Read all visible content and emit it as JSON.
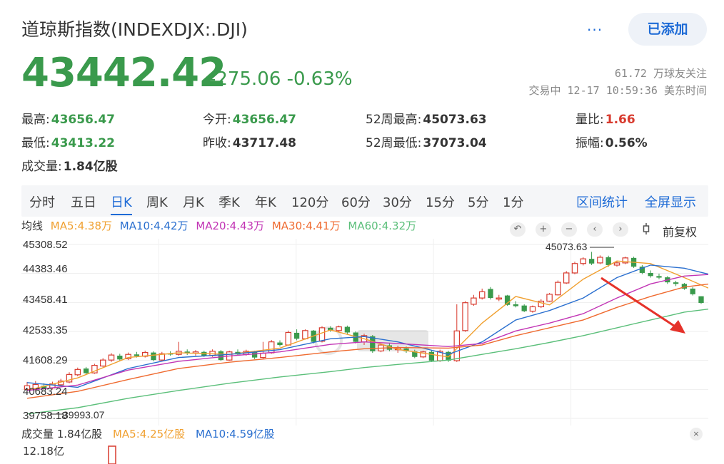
{
  "header": {
    "title": "道琼斯指数(INDEXDJX:.DJI)",
    "more_label": "···",
    "add_label": "已添加",
    "price": "43442.42",
    "change": "-275.06 -0.63%",
    "followers": "61.72 万球友关注",
    "trade_time": "交易中 12-17 10:59:36 美东时间"
  },
  "stats": {
    "high_label": "最高:",
    "high": "43656.47",
    "open_label": "今开:",
    "open": "43656.47",
    "w52high_label": "52周最高:",
    "w52high": "45073.63",
    "volratio_label": "量比:",
    "volratio": "1.66",
    "low_label": "最低:",
    "low": "43413.22",
    "prevclose_label": "昨收:",
    "prevclose": "43717.48",
    "w52low_label": "52周最低:",
    "w52low": "37073.04",
    "amplitude_label": "振幅:",
    "amplitude": "0.56%",
    "volume_label": "成交量:",
    "volume": "1.84亿股"
  },
  "tabs": [
    "分时",
    "五日",
    "日K",
    "周K",
    "月K",
    "季K",
    "年K",
    "120分",
    "60分",
    "30分",
    "15分",
    "5分",
    "1分"
  ],
  "active_tab": "日K",
  "tab_links": {
    "range_stats": "区间统计",
    "fullscreen": "全屏显示"
  },
  "ma": {
    "label": "均线",
    "ma5": "MA5:4.38万",
    "ma10": "MA10:4.42万",
    "ma20": "MA20:4.43万",
    "ma30": "MA30:4.41万",
    "ma60": "MA60:4.32万"
  },
  "controls": {
    "undo": "↶",
    "zoom_in": "+",
    "zoom_out": "−",
    "prev": "‹",
    "next": "›",
    "fuquan": "前复权"
  },
  "colors": {
    "up": "#d83a2e",
    "down": "#3a9a4c",
    "ma5": "#f0a030",
    "ma10": "#2a6fcf",
    "ma20": "#c235b5",
    "ma30": "#ef6a2f",
    "ma60": "#5bbf7a",
    "accent": "#1e6bd6"
  },
  "chart_data": {
    "type": "candlestick",
    "y_ticks": [
      "45308.52",
      "44383.46",
      "43458.41",
      "42533.35",
      "41608.29",
      "40683.24",
      "39758.18"
    ],
    "ylim": [
      39758.18,
      45308.52
    ],
    "annotations": {
      "max": "45073.63",
      "min": "39993.07"
    },
    "candles": [
      [
        40683,
        40800,
        40600,
        40920
      ],
      [
        40700,
        40840,
        40640,
        40950
      ],
      [
        40800,
        40720,
        40660,
        40880
      ],
      [
        40730,
        40860,
        40680,
        40930
      ],
      [
        40830,
        40950,
        40790,
        41020
      ],
      [
        40920,
        41160,
        40880,
        41230
      ],
      [
        41150,
        41320,
        41100,
        41380
      ],
      [
        41350,
        41200,
        41150,
        41400
      ],
      [
        41210,
        41450,
        41180,
        41500
      ],
      [
        41430,
        41620,
        41400,
        41680
      ],
      [
        41620,
        41780,
        41560,
        41840
      ],
      [
        41760,
        41640,
        41600,
        41820
      ],
      [
        41660,
        41800,
        41620,
        41860
      ],
      [
        41800,
        41750,
        41700,
        41880
      ],
      [
        41740,
        41860,
        41700,
        41920
      ],
      [
        41860,
        41620,
        41580,
        41900
      ],
      [
        41620,
        41820,
        41590,
        41880
      ],
      [
        41830,
        41800,
        41760,
        41900
      ],
      [
        41800,
        41900,
        41760,
        42200
      ],
      [
        41890,
        41850,
        41780,
        41960
      ],
      [
        41840,
        41880,
        41760,
        41940
      ],
      [
        41880,
        41760,
        41720,
        41920
      ],
      [
        41760,
        41900,
        41720,
        41960
      ],
      [
        41900,
        41620,
        41590,
        41940
      ],
      [
        41620,
        41880,
        41600,
        41920
      ],
      [
        41880,
        41800,
        41770,
        41960
      ],
      [
        41800,
        41900,
        41760,
        41950
      ],
      [
        41880,
        41700,
        41650,
        41920
      ],
      [
        41700,
        41840,
        41660,
        42200
      ],
      [
        41850,
        42200,
        41820,
        42260
      ],
      [
        42180,
        42100,
        42050,
        42250
      ],
      [
        42100,
        42500,
        42070,
        42560
      ],
      [
        42490,
        42300,
        42250,
        42600
      ],
      [
        42300,
        42560,
        42270,
        42600
      ],
      [
        42560,
        42200,
        42150,
        42580
      ],
      [
        42220,
        42650,
        42180,
        42700
      ],
      [
        42650,
        42560,
        42520,
        42700
      ],
      [
        42560,
        42680,
        42520,
        42720
      ],
      [
        42680,
        42500,
        42450,
        42720
      ],
      [
        42500,
        42200,
        42150,
        42540
      ],
      [
        42200,
        42400,
        42100,
        42460
      ],
      [
        42380,
        41900,
        41850,
        42420
      ],
      [
        41910,
        42100,
        41870,
        42150
      ],
      [
        42090,
        41950,
        41900,
        42150
      ],
      [
        41950,
        42000,
        41850,
        42080
      ],
      [
        41990,
        41900,
        41850,
        42050
      ],
      [
        41900,
        41720,
        41680,
        41950
      ],
      [
        41720,
        41880,
        41680,
        41920
      ],
      [
        41880,
        41600,
        41560,
        41920
      ],
      [
        41600,
        41900,
        41560,
        41950
      ],
      [
        41880,
        41600,
        41560,
        41920
      ],
      [
        41600,
        42550,
        41560,
        43400
      ],
      [
        42560,
        43450,
        42520,
        43500
      ],
      [
        43400,
        43600,
        43350,
        43700
      ],
      [
        43600,
        43800,
        43550,
        43900
      ],
      [
        43890,
        43600,
        43550,
        43950
      ],
      [
        43600,
        43600,
        43500,
        43700
      ],
      [
        43680,
        43380,
        43350,
        43700
      ],
      [
        43400,
        43340,
        43300,
        43500
      ],
      [
        43360,
        43180,
        43150,
        43400
      ],
      [
        43180,
        43320,
        43130,
        43360
      ],
      [
        43320,
        43500,
        43280,
        43560
      ],
      [
        43500,
        43720,
        43480,
        43760
      ],
      [
        43700,
        44100,
        43680,
        44160
      ],
      [
        44080,
        44400,
        44050,
        44460
      ],
      [
        44400,
        44700,
        44360,
        44760
      ],
      [
        44700,
        44850,
        44640,
        44900
      ],
      [
        44850,
        44700,
        44650,
        45073.63
      ],
      [
        44720,
        44900,
        44680,
        44960
      ],
      [
        44900,
        44650,
        44600,
        44950
      ],
      [
        44650,
        44720,
        44600,
        44780
      ],
      [
        44720,
        44880,
        44680,
        44920
      ],
      [
        44880,
        44600,
        44560,
        44920
      ],
      [
        44600,
        44400,
        44360,
        44650
      ],
      [
        44400,
        44300,
        44250,
        44480
      ],
      [
        44300,
        44250,
        44200,
        44380
      ],
      [
        44260,
        44100,
        44050,
        44300
      ],
      [
        44100,
        44050,
        43980,
        44150
      ],
      [
        44050,
        43900,
        43860,
        44080
      ],
      [
        43900,
        43720,
        43680,
        43950
      ],
      [
        43656.47,
        43442.42,
        43413.22,
        43656.47
      ]
    ],
    "ma_lines": {
      "ma5": [
        [
          0,
          40650
        ],
        [
          6,
          41050
        ],
        [
          12,
          41700
        ],
        [
          18,
          41850
        ],
        [
          24,
          41800
        ],
        [
          30,
          42000
        ],
        [
          36,
          42580
        ],
        [
          40,
          42300
        ],
        [
          44,
          41960
        ],
        [
          50,
          41720
        ],
        [
          54,
          42800
        ],
        [
          58,
          43650
        ],
        [
          62,
          43380
        ],
        [
          66,
          44200
        ],
        [
          70,
          44780
        ],
        [
          74,
          44700
        ],
        [
          78,
          44250
        ],
        [
          81,
          43900
        ]
      ],
      "ma10": [
        [
          0,
          40900
        ],
        [
          6,
          40750
        ],
        [
          12,
          41350
        ],
        [
          18,
          41700
        ],
        [
          24,
          41800
        ],
        [
          30,
          41950
        ],
        [
          36,
          42300
        ],
        [
          40,
          42370
        ],
        [
          44,
          42200
        ],
        [
          50,
          41800
        ],
        [
          54,
          42200
        ],
        [
          58,
          42900
        ],
        [
          62,
          43200
        ],
        [
          66,
          43600
        ],
        [
          70,
          44250
        ],
        [
          74,
          44650
        ],
        [
          78,
          44550
        ],
        [
          81,
          44350
        ]
      ],
      "ma20": [
        [
          0,
          40650
        ],
        [
          6,
          40820
        ],
        [
          12,
          41300
        ],
        [
          18,
          41580
        ],
        [
          24,
          41750
        ],
        [
          30,
          41880
        ],
        [
          36,
          42120
        ],
        [
          40,
          42200
        ],
        [
          44,
          42150
        ],
        [
          50,
          42050
        ],
        [
          54,
          42150
        ],
        [
          58,
          42550
        ],
        [
          62,
          42800
        ],
        [
          66,
          43100
        ],
        [
          70,
          43600
        ],
        [
          74,
          44050
        ],
        [
          78,
          44300
        ],
        [
          81,
          44350
        ]
      ],
      "ma30": [
        [
          0,
          40400
        ],
        [
          6,
          40620
        ],
        [
          12,
          41000
        ],
        [
          18,
          41350
        ],
        [
          24,
          41550
        ],
        [
          30,
          41700
        ],
        [
          36,
          41880
        ],
        [
          40,
          41980
        ],
        [
          44,
          42020
        ],
        [
          50,
          42000
        ],
        [
          54,
          42100
        ],
        [
          58,
          42400
        ],
        [
          62,
          42650
        ],
        [
          66,
          42900
        ],
        [
          70,
          43300
        ],
        [
          74,
          43650
        ],
        [
          78,
          43950
        ],
        [
          81,
          44050
        ]
      ],
      "ma60": [
        [
          0,
          39900
        ],
        [
          6,
          40100
        ],
        [
          12,
          40400
        ],
        [
          18,
          40650
        ],
        [
          24,
          40880
        ],
        [
          30,
          41080
        ],
        [
          36,
          41250
        ],
        [
          40,
          41380
        ],
        [
          44,
          41480
        ],
        [
          50,
          41620
        ],
        [
          54,
          41800
        ],
        [
          58,
          41980
        ],
        [
          62,
          42180
        ],
        [
          66,
          42400
        ],
        [
          70,
          42650
        ],
        [
          74,
          42900
        ],
        [
          78,
          43150
        ],
        [
          81,
          43250
        ]
      ]
    }
  },
  "volume": {
    "label": "成交量 1.84亿股",
    "ma5": "MA5:4.25亿股",
    "ma10": "MA10:4.59亿股",
    "max_label": "12.18亿",
    "close": "×"
  }
}
